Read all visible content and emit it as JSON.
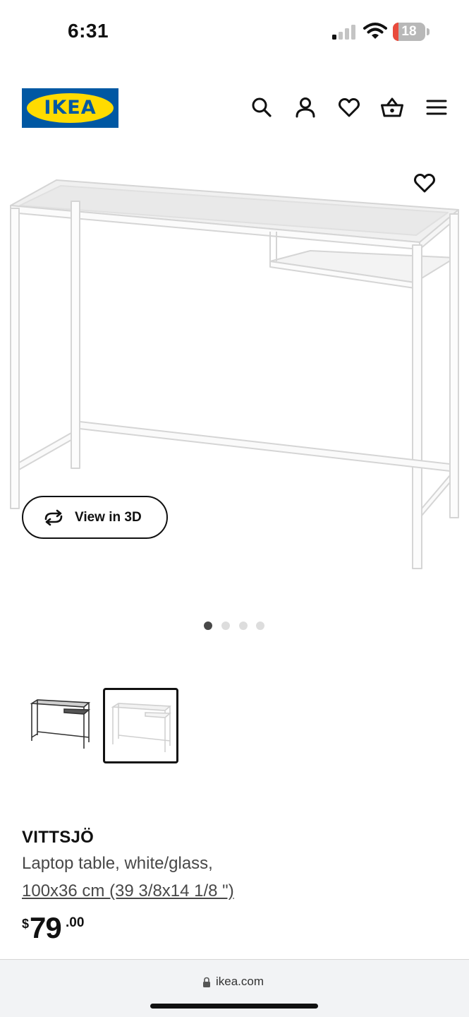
{
  "status_bar": {
    "time": "6:31",
    "battery_level": "18",
    "battery_fraction": 0.18,
    "signal_bars_active": 1,
    "signal_bars_total": 4,
    "icons": [
      "signal-icon",
      "wifi-icon",
      "battery-icon"
    ]
  },
  "header": {
    "logo_text": "IKEA",
    "icons": [
      "search-icon",
      "account-icon",
      "heart-icon",
      "basket-icon",
      "menu-icon"
    ],
    "colors": {
      "brand_blue": "#0058a3",
      "brand_yellow": "#ffdb00"
    }
  },
  "gallery": {
    "favorite_icon": "heart-icon",
    "view_3d_label": "View in 3D",
    "view_3d_icon": "rotate-arrows-icon",
    "dots_total": 4,
    "active_dot": 1,
    "thumbnails": [
      {
        "variant": "black",
        "selected": false
      },
      {
        "variant": "white",
        "selected": true
      }
    ]
  },
  "product": {
    "name": "VITTSJÖ",
    "description": "Laptop table, white/glass,",
    "size": "100x36 cm (39 3/8x14 1/8 \")",
    "price_currency": "$",
    "price_integer": "79",
    "price_decimal": ".00"
  },
  "browser": {
    "url": "ikea.com",
    "lock_icon": "lock-icon"
  }
}
